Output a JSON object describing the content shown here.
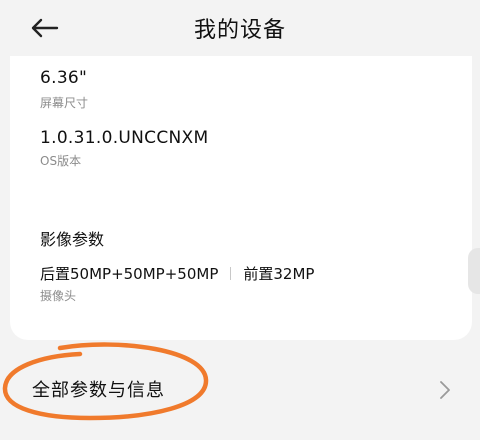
{
  "header": {
    "title": "我的设备",
    "back_icon": "arrow-left-icon"
  },
  "specs": {
    "screen": {
      "value": "6.36\"",
      "label": "屏幕尺寸"
    },
    "os": {
      "value": "1.0.31.0.UNCCNXM",
      "label": "OS版本"
    },
    "camera": {
      "section_title": "影像参数",
      "rear": "后置50MP+50MP+50MP",
      "front": "前置32MP",
      "label": "摄像头"
    }
  },
  "all_params": {
    "label": "全部参数与信息",
    "chevron_icon": "chevron-right-icon"
  },
  "colors": {
    "background": "#f3f3f3",
    "card": "#ffffff",
    "annotation": "#f07a2c",
    "secondary_text": "#8c8c8c"
  }
}
